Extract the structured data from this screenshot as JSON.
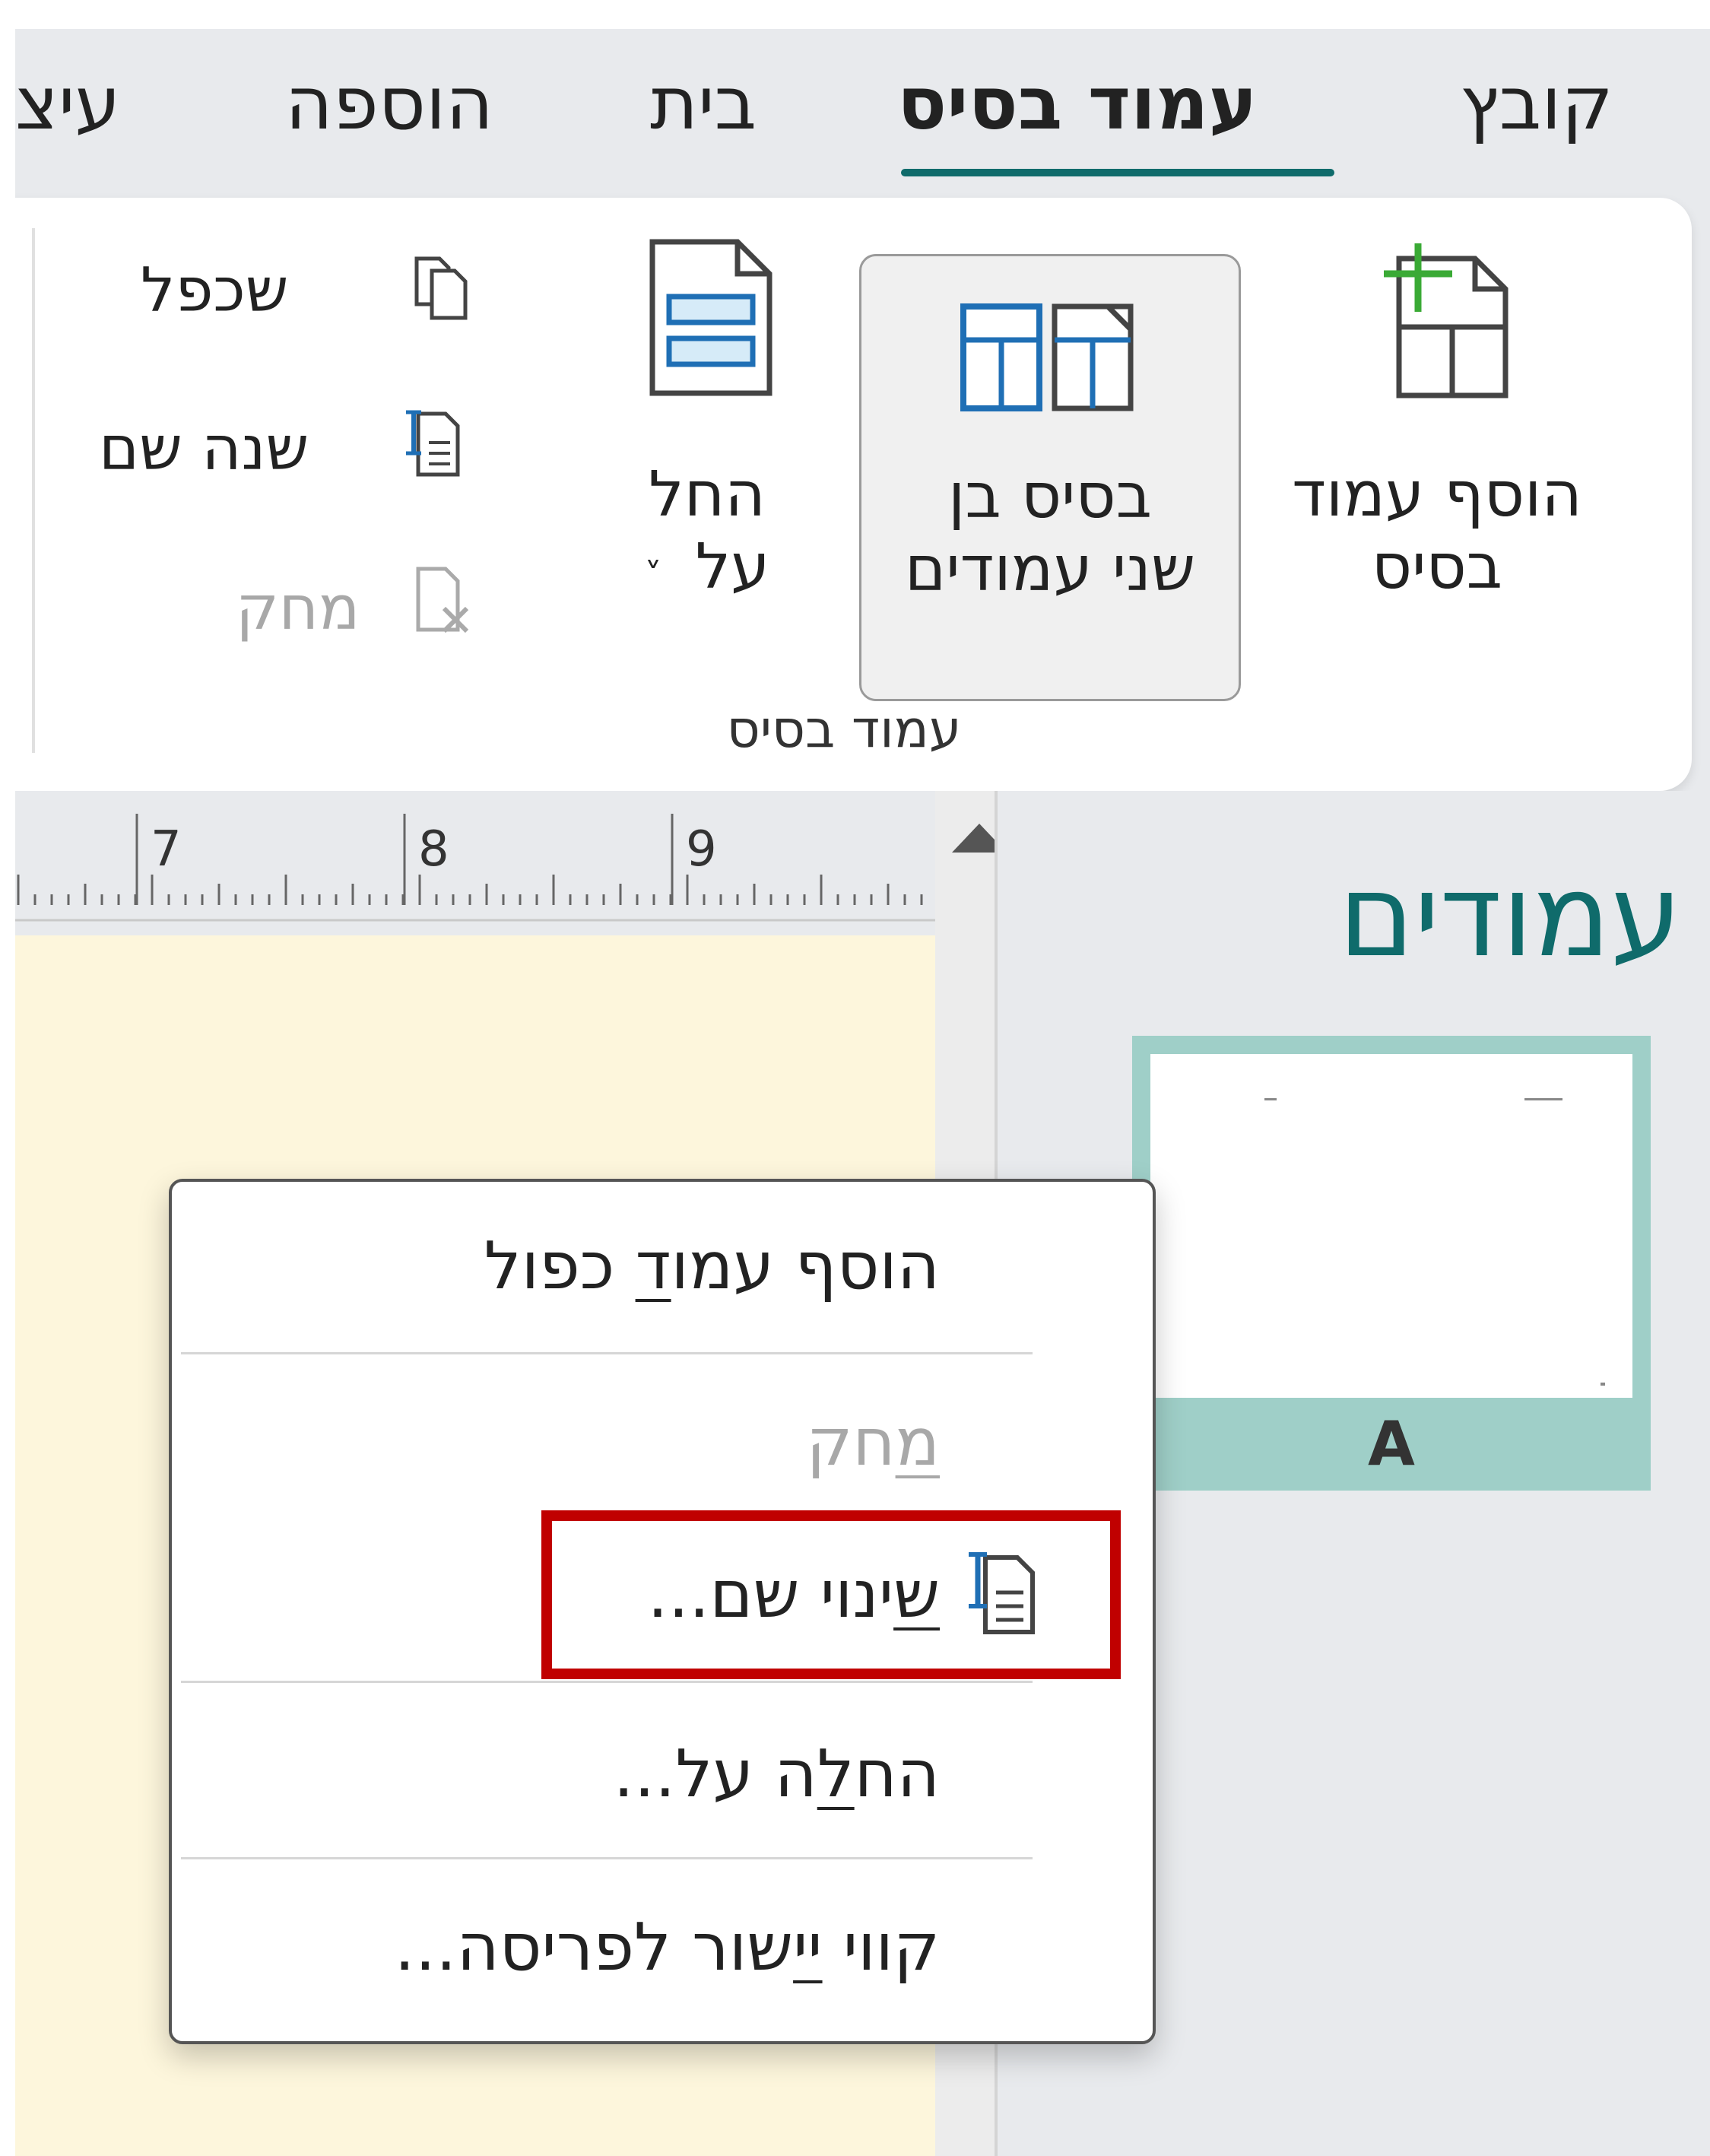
{
  "tabs": [
    {
      "label": "קובץ"
    },
    {
      "label": "עמוד בסיס",
      "active": true
    },
    {
      "label": "בית"
    },
    {
      "label": "הוספה"
    },
    {
      "label": "עיצ"
    }
  ],
  "ribbon": {
    "add_master_page": {
      "line1": "הוסף עמוד",
      "line2": "בסיס"
    },
    "two_page_master": {
      "line1": "בסיס בן",
      "line2": "שני עמודים"
    },
    "apply_to": {
      "line1": "החל",
      "line2": "על",
      "chevron": "˅"
    },
    "duplicate": "שכפל",
    "rename": "שנה שם",
    "delete": "מחק",
    "group_label": "עמוד בסיס"
  },
  "ruler": {
    "numbers": [
      "7",
      "8",
      "9"
    ]
  },
  "pages_pane": {
    "title": "עמודים",
    "thumbnail_label": "A"
  },
  "context_menu": {
    "items": [
      {
        "pre": "הוסף עמו",
        "u": "ד",
        "post": " כפול",
        "disabled": false
      },
      {
        "pre": "",
        "u": "מ",
        "post": "חק",
        "disabled": true
      },
      {
        "pre": "",
        "u": "ש",
        "post": "ינוי שם...",
        "disabled": false,
        "highlighted": true
      },
      {
        "pre": "הח",
        "u": "ל",
        "post": "ה על...",
        "disabled": false
      },
      {
        "pre": "קווי ",
        "u": "יי",
        "post": "שור לפריסה...",
        "disabled": false
      }
    ]
  },
  "colors": {
    "accent": "#0f6b6b",
    "highlight_box": "#c00000",
    "document_bg": "#fdf6dc",
    "thumbnail_frame": "#9fcfc8"
  },
  "icons": [
    "add-master-page-icon",
    "two-page-master-icon",
    "apply-to-icon",
    "duplicate-icon",
    "rename-icon",
    "delete-icon",
    "scroll-up-icon"
  ]
}
